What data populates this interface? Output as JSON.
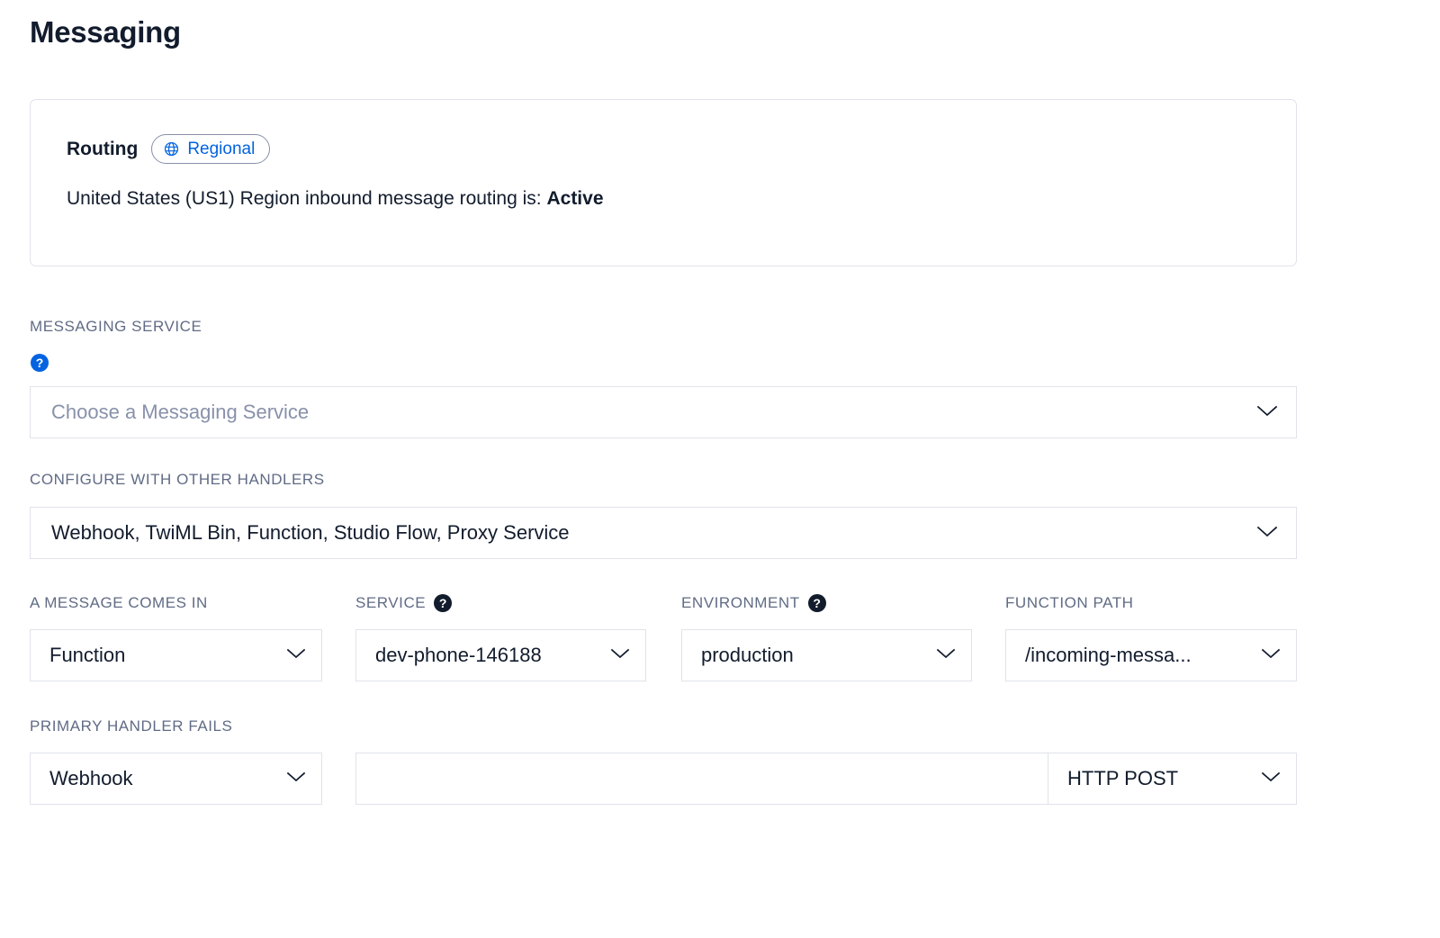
{
  "page": {
    "title": "Messaging"
  },
  "routing_card": {
    "label": "Routing",
    "badge": {
      "text": "Regional",
      "icon": "globe-icon",
      "text_color": "#0263e0",
      "border_color": "#8891aa"
    },
    "status_prefix": "United States (US1) Region inbound message routing is:",
    "status_value": "Active"
  },
  "messaging_service": {
    "label": "MESSAGING SERVICE",
    "help_icon": "help-circle-icon",
    "help_icon_color": "#0263e0",
    "placeholder": "Choose a Messaging Service",
    "value": "",
    "chevron": "chevron-down-icon"
  },
  "handlers": {
    "label": "CONFIGURE WITH OTHER HANDLERS",
    "value": "Webhook, TwiML Bin, Function, Studio Flow, Proxy Service",
    "chevron": "chevron-down-icon"
  },
  "primary_handler": {
    "message_comes_in": {
      "label": "A MESSAGE COMES IN",
      "value": "Function"
    },
    "service": {
      "label": "SERVICE",
      "help_icon": "help-circle-icon",
      "help_icon_color": "#121c2d",
      "value": "dev-phone-146188"
    },
    "environment": {
      "label": "ENVIRONMENT",
      "help_icon": "help-circle-icon",
      "help_icon_color": "#121c2d",
      "value": "production"
    },
    "function_path": {
      "label": "FUNCTION PATH",
      "value": "/incoming-messa..."
    }
  },
  "fallback_handler": {
    "label": "PRIMARY HANDLER FAILS",
    "handler": {
      "value": "Webhook"
    },
    "url": {
      "value": "",
      "placeholder": ""
    },
    "method": {
      "value": "HTTP POST"
    }
  },
  "colors": {
    "accent_blue": "#0263e0",
    "text_dark": "#121c2d",
    "text_muted": "#606b85",
    "placeholder": "#8891aa",
    "border": "#e1e3ea"
  }
}
